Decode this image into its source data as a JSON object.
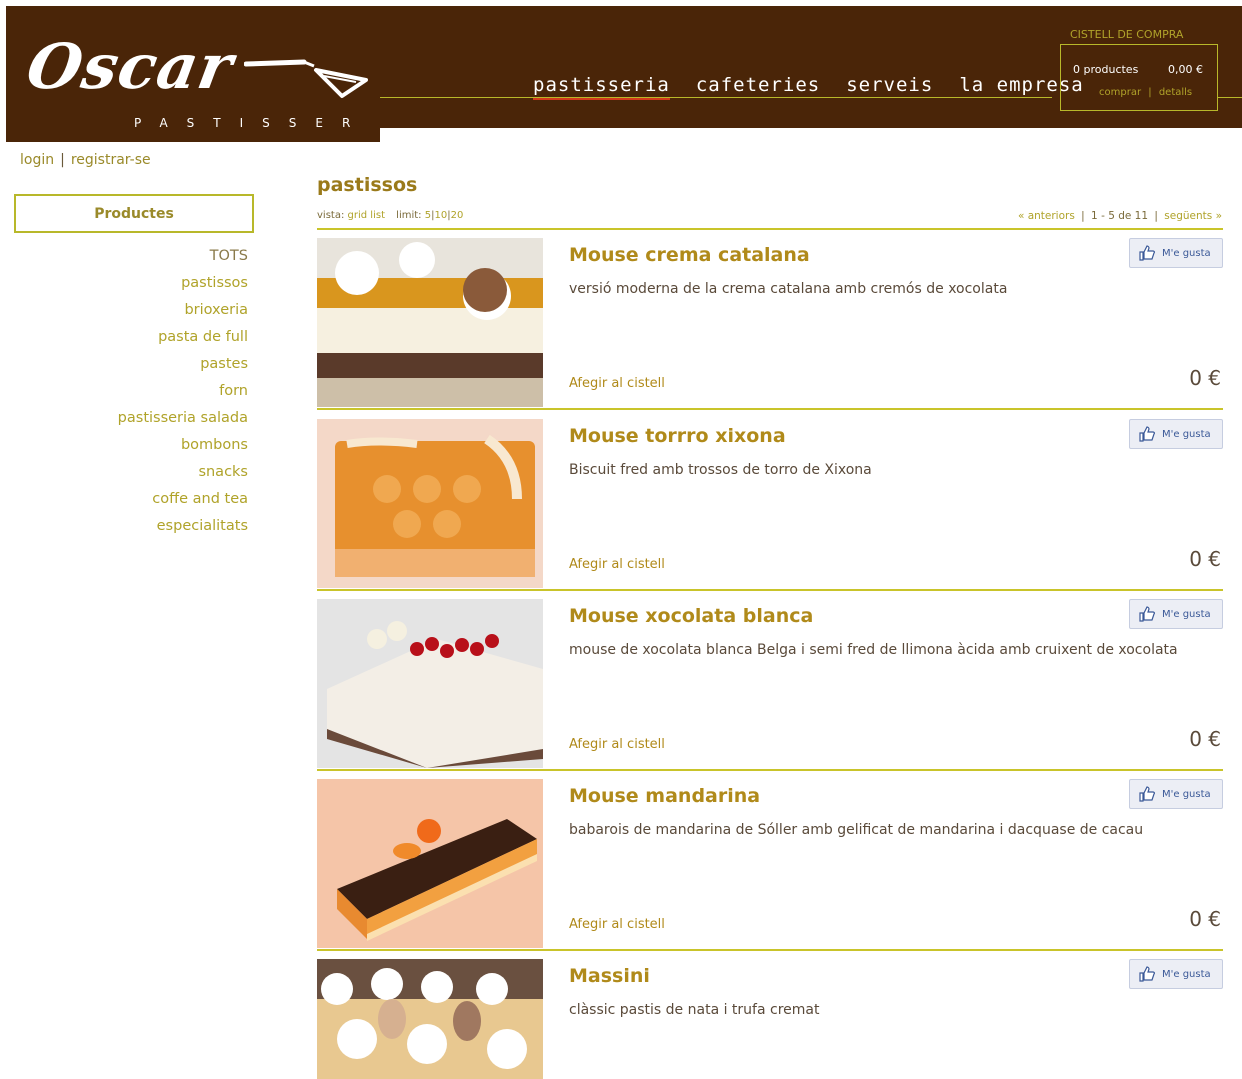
{
  "brand": {
    "script": "Oscar",
    "subtitle": "PASTISSER"
  },
  "nav": {
    "items": [
      "pastisseria",
      "cafeteries",
      "serveis",
      "la empresa"
    ]
  },
  "cart": {
    "title": "CISTELL DE COMPRA",
    "count": "0 productes",
    "total": "0,00 €",
    "buy": "comprar",
    "divider": "|",
    "details": "detalls"
  },
  "auth": {
    "login": "login",
    "divider": "|",
    "register": "registrar-se"
  },
  "sidebar": {
    "heading": "Productes",
    "items": [
      "TOTS",
      "pastissos",
      "brioxeria",
      "pasta de full",
      "pastes",
      "forn",
      "pastisseria salada",
      "bombons",
      "snacks",
      "coffe and tea",
      "especialitats"
    ]
  },
  "main": {
    "title": "pastissos",
    "view_label": "vista:",
    "view_grid": "grid",
    "view_list": "list",
    "limit_label": "limit:",
    "limit_5": "5",
    "limit_10": "10",
    "limit_20": "20",
    "pipe": "|",
    "prev": "« anteriors",
    "range": "1 - 5 de 11",
    "next": "següents »"
  },
  "like_label": "M'e gusta",
  "add_label": "Afegir al cistell",
  "products": [
    {
      "name": "Mouse crema catalana",
      "desc": "versió moderna de la crema catalana amb cremós de xocolata",
      "price": "0 €"
    },
    {
      "name": "Mouse torrro xixona",
      "desc": "Biscuit fred amb trossos de torro de Xixona",
      "price": "0 €"
    },
    {
      "name": "Mouse xocolata blanca",
      "desc": "mouse de xocolata blanca Belga i semi fred de llimona àcida amb cruixent de xocolata",
      "price": "0 €"
    },
    {
      "name": "Mouse mandarina",
      "desc": "babarois de mandarina de Sóller amb gelificat de mandarina i dacquase de cacau",
      "price": "0 €"
    },
    {
      "name": "Massini",
      "desc": "clàssic pastis de nata i trufa cremat",
      "price": ""
    }
  ],
  "colors": {
    "header_bg": "#4a2508",
    "accent_olive": "#b0a32a",
    "title_gold": "#b08a1a",
    "nav_active": "#d23a1a"
  }
}
